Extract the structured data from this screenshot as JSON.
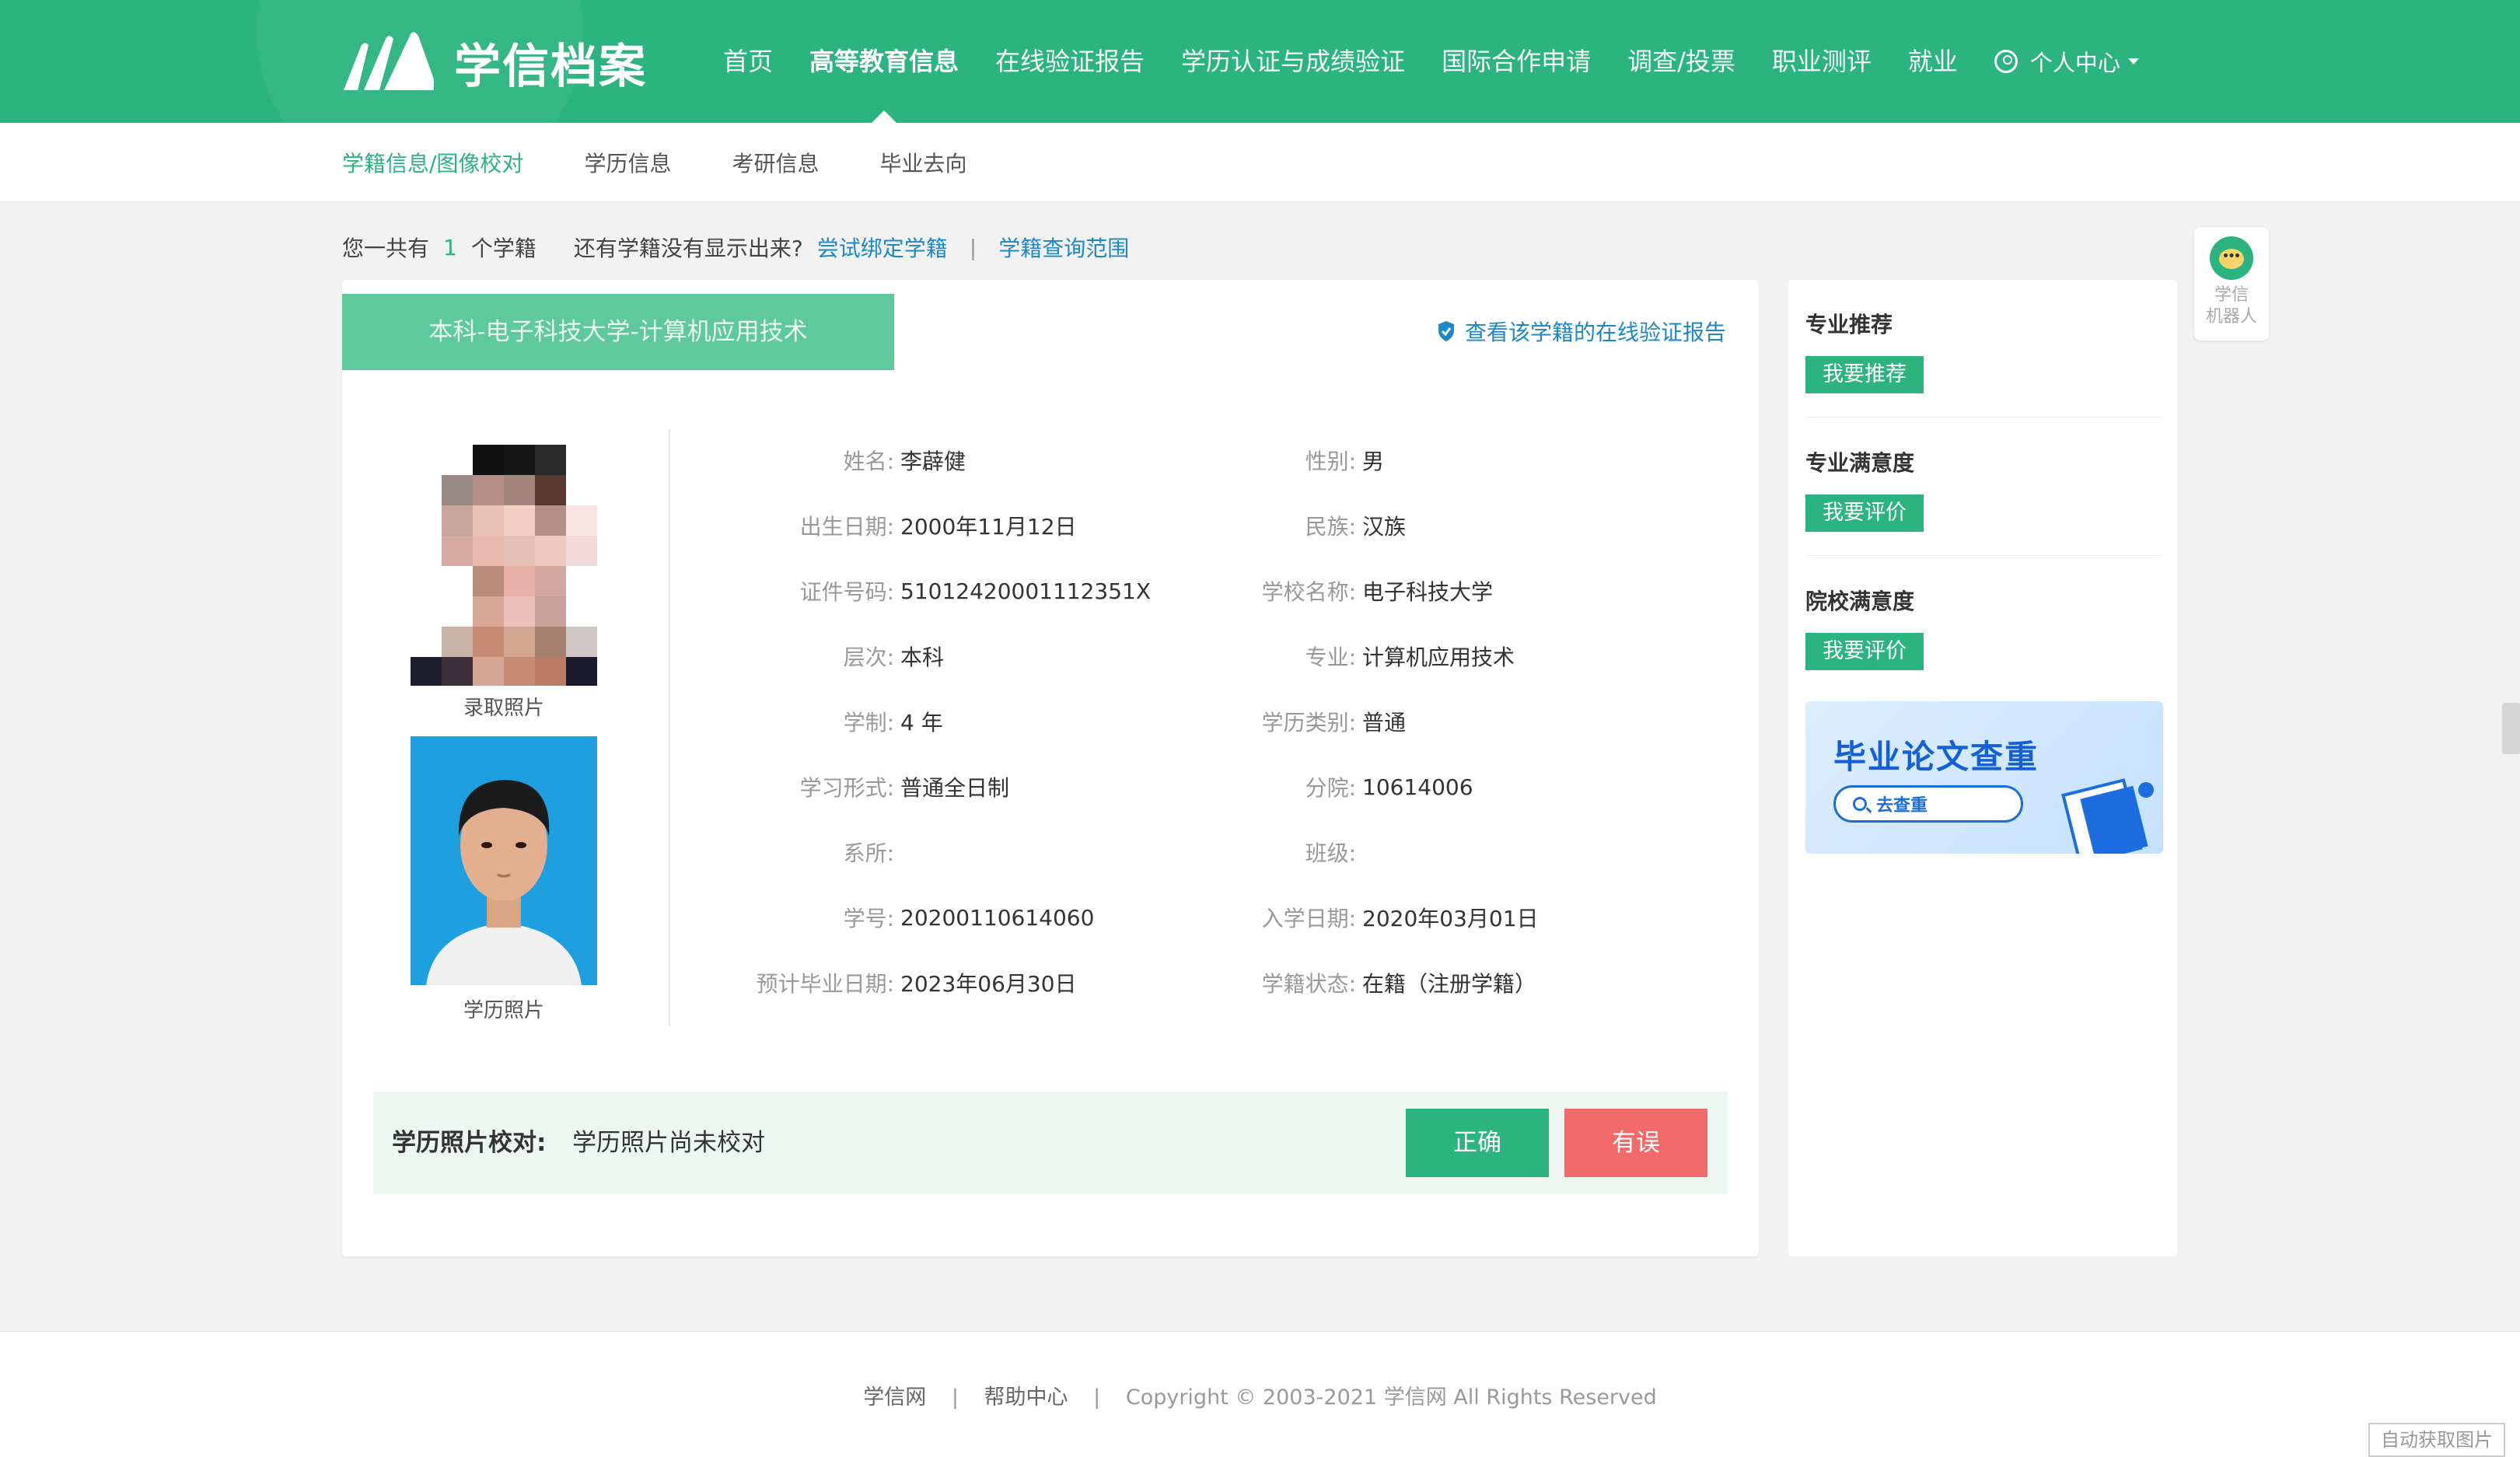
{
  "header": {
    "logo_text": "学信档案",
    "nav": [
      "首页",
      "高等教育信息",
      "在线验证报告",
      "学历认证与成绩验证",
      "国际合作申请",
      "调查/投票",
      "职业测评",
      "就业"
    ],
    "user_menu": "个人中心",
    "accent_color": "#2bb47f"
  },
  "subnav": [
    "学籍信息/图像校对",
    "学历信息",
    "考研信息",
    "毕业去向"
  ],
  "summary": {
    "prefix": "您一共有",
    "count": "1",
    "suffix": "个学籍",
    "question": "还有学籍没有显示出来?",
    "bind_link": "尝试绑定学籍",
    "separator": "|",
    "scope_link": "学籍查询范围"
  },
  "record": {
    "tab_title": "本科-电子科技大学-计算机应用技术",
    "report_link": "查看该学籍的在线验证报告",
    "photo_admission_label": "录取照片",
    "photo_degree_label": "学历照片",
    "fields": [
      [
        {
          "label": "姓名:",
          "value": "李薜健"
        },
        {
          "label": "性别:",
          "value": "男"
        }
      ],
      [
        {
          "label": "出生日期:",
          "value": "2000年11月12日"
        },
        {
          "label": "民族:",
          "value": "汉族"
        }
      ],
      [
        {
          "label": "证件号码:",
          "value": "51012420001112351X"
        },
        {
          "label": "学校名称:",
          "value": "电子科技大学"
        }
      ],
      [
        {
          "label": "层次:",
          "value": "本科"
        },
        {
          "label": "专业:",
          "value": "计算机应用技术"
        }
      ],
      [
        {
          "label": "学制:",
          "value": "4 年"
        },
        {
          "label": "学历类别:",
          "value": "普通"
        }
      ],
      [
        {
          "label": "学习形式:",
          "value": "普通全日制"
        },
        {
          "label": "分院:",
          "value": "10614006"
        }
      ],
      [
        {
          "label": "系所:",
          "value": ""
        },
        {
          "label": "班级:",
          "value": ""
        }
      ],
      [
        {
          "label": "学号:",
          "value": "20200110614060"
        },
        {
          "label": "入学日期:",
          "value": "2020年03月01日"
        }
      ],
      [
        {
          "label": "预计毕业日期:",
          "value": "2023年06月30日"
        },
        {
          "label": "学籍状态:",
          "value": "在籍（注册学籍）"
        }
      ]
    ],
    "check_label": "学历照片校对:",
    "check_value": "学历照片尚未校对",
    "btn_correct": "正确",
    "btn_wrong": "有误"
  },
  "sidebar": {
    "blocks": [
      {
        "title": "专业推荐",
        "button": "我要推荐"
      },
      {
        "title": "专业满意度",
        "button": "我要评价"
      },
      {
        "title": "院校满意度",
        "button": "我要评价"
      }
    ],
    "promo_title": "毕业论文查重",
    "promo_button": "去查重"
  },
  "robot": {
    "line1": "学信",
    "line2": "机器人"
  },
  "footer": {
    "link1": "学信网",
    "link2": "帮助中心",
    "separator": "|",
    "copyright": "Copyright © 2003-2021 学信网 All Rights Reserved"
  },
  "auto_capture": "自动获取图片"
}
